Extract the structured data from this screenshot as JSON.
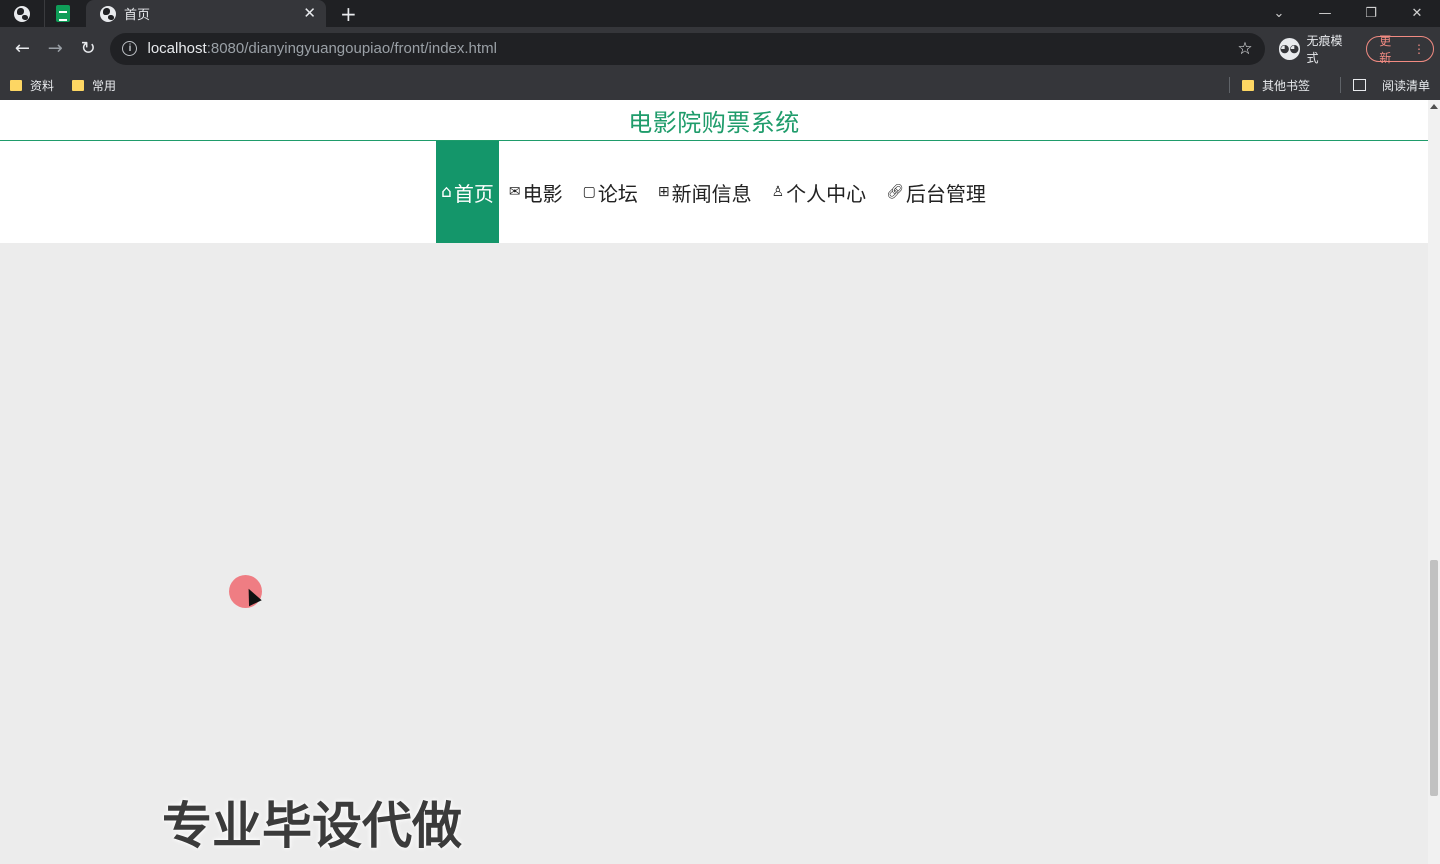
{
  "browser": {
    "tab_title": "首页",
    "url_host": "localhost",
    "url_path": ":8080/dianyingyuangoupiao/front/index.html",
    "profile_label": "无痕模式",
    "update_label": "更新",
    "bookmarks_left": [
      "资料",
      "常用"
    ],
    "bookmarks_other": "其他书签",
    "reading_list": "阅读清单"
  },
  "site": {
    "title": "电影院购票系统",
    "nav": [
      {
        "label": "首页",
        "icon": "home-icon"
      },
      {
        "label": "电影",
        "icon": "mail-icon"
      },
      {
        "label": "论坛",
        "icon": "note-icon"
      },
      {
        "label": "新闻信息",
        "icon": "gift-icon"
      },
      {
        "label": "个人中心",
        "icon": "user-icon"
      },
      {
        "label": "后台管理",
        "icon": "link-icon"
      }
    ]
  },
  "overlay": {
    "watermark": "专业毕设代做"
  },
  "colors": {
    "brand": "#1f9c6b",
    "nav_active_bg": "#14966a"
  }
}
